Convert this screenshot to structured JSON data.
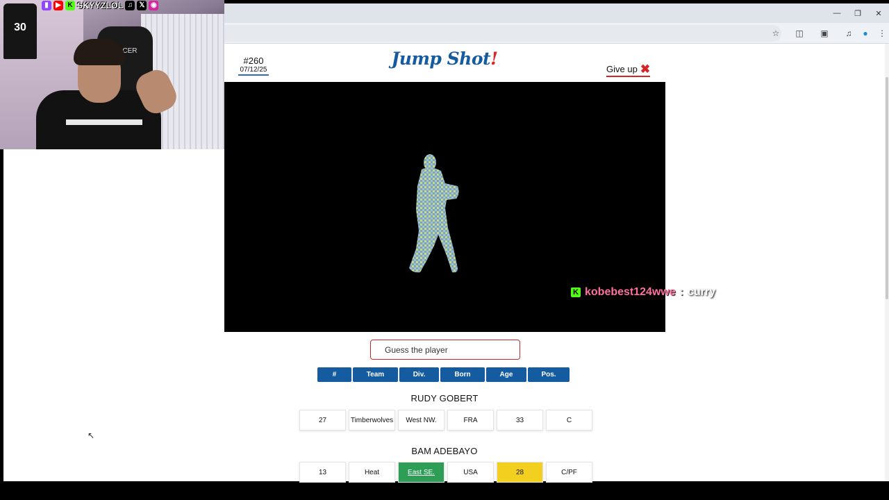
{
  "game": {
    "puzzle_number": "#260",
    "puzzle_date": "07/12/25",
    "title_main": "Jump Shot",
    "title_bang": "!",
    "give_up_label": "Give up",
    "guess_placeholder": "Guess the player",
    "headers": [
      {
        "label": "#",
        "w": 49
      },
      {
        "label": "Team",
        "w": 65
      },
      {
        "label": "Div.",
        "w": 57
      },
      {
        "label": "Born",
        "w": 64
      },
      {
        "label": "Age",
        "w": 58
      },
      {
        "label": "Pos.",
        "w": 60
      }
    ],
    "guesses": [
      {
        "name": "RUDY GOBERT",
        "cells": [
          {
            "value": "27",
            "status": "none"
          },
          {
            "value": "Timberwolves",
            "status": "none"
          },
          {
            "value": "West NW.",
            "status": "none"
          },
          {
            "value": "FRA",
            "status": "none"
          },
          {
            "value": "33",
            "status": "none"
          },
          {
            "value": "C",
            "status": "none"
          }
        ]
      },
      {
        "name": "BAM ADEBAYO",
        "cells": [
          {
            "value": "13",
            "status": "none"
          },
          {
            "value": "Heat",
            "status": "none"
          },
          {
            "value": "East SE.",
            "status": "correct"
          },
          {
            "value": "USA",
            "status": "none"
          },
          {
            "value": "28",
            "status": "close"
          },
          {
            "value": "C/PF",
            "status": "none"
          }
        ]
      }
    ],
    "colors": {
      "brand": "#155ba0",
      "accent": "#e02424",
      "correct": "#2e9e57",
      "close": "#f3cf1f"
    }
  },
  "chat": {
    "platform_icon": "kick-icon",
    "username": "kobebest124wwe",
    "separator": ":",
    "message": "curry"
  },
  "stream": {
    "channel_name": "SKYYZLOL",
    "jersey_number": "30",
    "chair_brand": "RACER"
  }
}
